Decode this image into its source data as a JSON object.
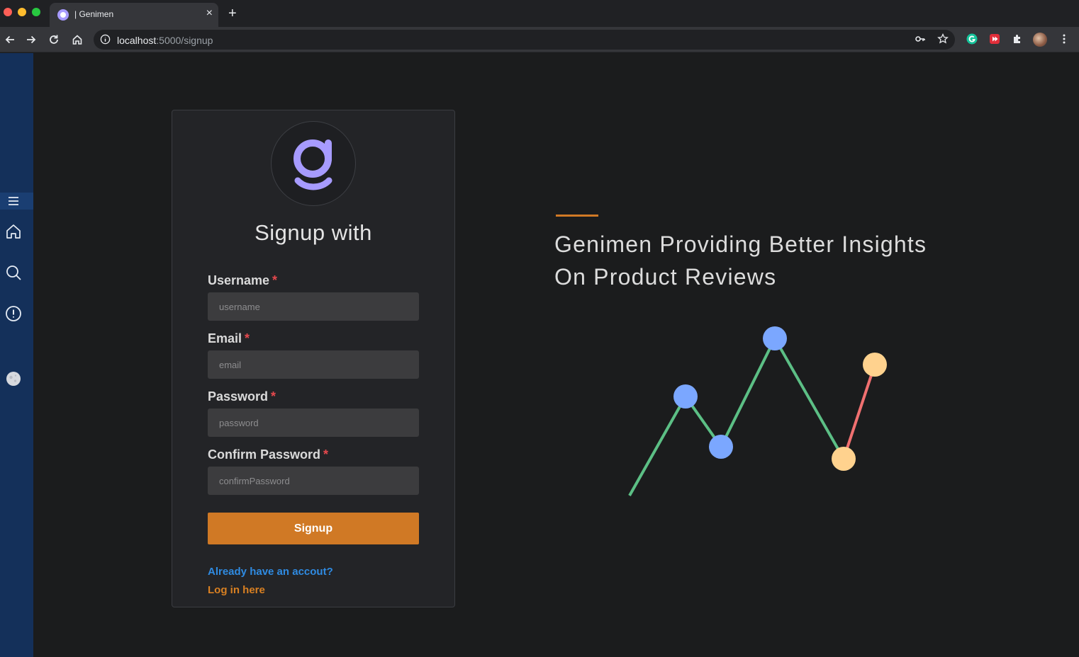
{
  "browser": {
    "tab_title": "| Genimen",
    "new_tab": "+",
    "close": "×",
    "url_host": "localhost",
    "url_path": ":5000/signup"
  },
  "sidebar": {
    "items": [
      {
        "icon": "menu-icon"
      },
      {
        "icon": "home-icon"
      },
      {
        "icon": "search-icon"
      },
      {
        "icon": "alert-icon"
      },
      {
        "icon": "moon-icon"
      }
    ]
  },
  "form": {
    "title": "Signup with",
    "username_label": "Username",
    "username_placeholder": "username",
    "email_label": "Email",
    "email_placeholder": "email",
    "password_label": "Password",
    "password_placeholder": "password",
    "confirm_label": "Confirm Password",
    "confirm_placeholder": "confirmPassword",
    "required_mark": "*",
    "submit_label": "Signup",
    "already_text": "Already have an accout?",
    "login_text": "Log in here"
  },
  "hero": {
    "line1": "Genimen Providing Better Insights",
    "line2": "On Product Reviews"
  },
  "colors": {
    "accent": "#d07925",
    "sidebar": "#14305a",
    "link": "#2f8be2",
    "logo": "#a79bff",
    "chart_green": "#5cbf85",
    "chart_red": "#f07070",
    "chart_blue": "#7ba7ff",
    "chart_yellow": "#ffd28e"
  }
}
